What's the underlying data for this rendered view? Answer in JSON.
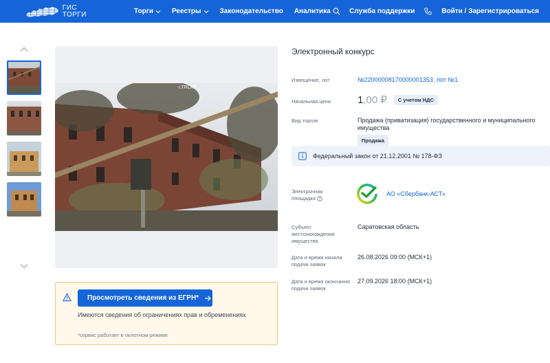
{
  "header": {
    "logo_line1": "ГИС",
    "logo_line2": "ТОРГИ",
    "nav": [
      {
        "label": "Торги",
        "has_dropdown": true
      },
      {
        "label": "Реестры",
        "has_dropdown": true
      },
      {
        "label": "Законодательство",
        "has_dropdown": false
      },
      {
        "label": "Аналитика",
        "has_dropdown": false
      }
    ],
    "support": "Служба поддержки",
    "login": "Войти / Зарегистрироваться",
    "bg_color": "#1565d8"
  },
  "egrn": {
    "button_label": "Просмотреть сведения из ЕГРН*",
    "message": "Имеются сведения об ограничениях прав и обременениях",
    "note": "*сервис работает в пилотном режиме"
  },
  "details": {
    "procedure_type": "Электронный конкурс",
    "notice_label": "Извещение, лот",
    "notice_value": "№22000008170000001353, лот №1",
    "price_label": "Начальная цена",
    "price_int": "1",
    "price_dec": ",00 ₽",
    "vat_tag": "С учетом НДС",
    "trade_type_label": "Вид торгов",
    "trade_type_value_line1": "Продажа (приватизация) государственного и муниципального",
    "trade_type_value_line2": "имущества",
    "trade_tag": "Продажа",
    "law": "Федеральный закон от 21.12.2001 № 178-ФЗ",
    "platform_label_line1": "Электронная",
    "platform_label_line2": "площадка",
    "platform_name": "АО «Сбербанк-АСТ»",
    "subject_label_line1": "Субъект",
    "subject_label_line2": "местонахождения",
    "subject_label_line3": "имущества",
    "subject_value": "Саратовская область",
    "start_label_line1": "Дата и время начала",
    "start_label_line2": "подачи заявок",
    "start_value": "26.08.2026 09:00 (МСК+1)",
    "end_label_line1": "Дата и время окончания",
    "end_label_line2": "подачи заявок",
    "end_value": "27.09.2026 18:00 (МСК+1)"
  },
  "photo_watermark": "i.TRLAT"
}
